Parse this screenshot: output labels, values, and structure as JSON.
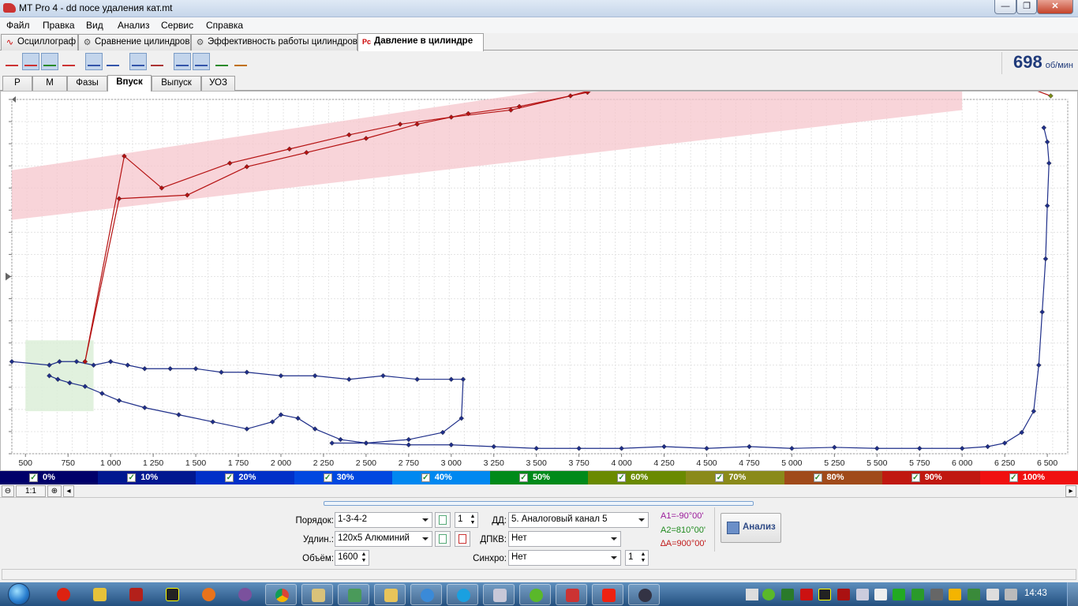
{
  "window": {
    "title": "MT Pro 4 - dd посе удаления кат.mt",
    "min_label": "—",
    "max_label": "❐",
    "close_label": "✕"
  },
  "menu": [
    "Файл",
    "Правка",
    "Вид",
    "Анализ",
    "Сервис",
    "Справка"
  ],
  "main_tabs": [
    {
      "label": "Осциллограф",
      "icon": "∿"
    },
    {
      "label": "Сравнение цилиндров",
      "icon": "⚙"
    },
    {
      "label": "Эффективность работы цилиндров",
      "icon": "⚙"
    },
    {
      "label": "Давление в цилиндре",
      "icon": "Pc"
    }
  ],
  "rpm": {
    "value": "698",
    "unit": "об/мин"
  },
  "sub_tabs": [
    "P",
    "M",
    "Фазы",
    "Впуск",
    "Выпуск",
    "УОЗ"
  ],
  "colors": {
    "band_fill": "#f5c6cc",
    "green_zone": "#dcefd8",
    "trace_blue": "#1f2f8a",
    "trace_red": "#b51212",
    "trace_olive": "#7a8a18"
  },
  "chart_data": {
    "type": "line",
    "x_ticks": [
      "500",
      "750",
      "1 000",
      "1 250",
      "1 500",
      "1 750",
      "2 000",
      "2 250",
      "2 500",
      "2 750",
      "3 000",
      "3 250",
      "3 500",
      "3 750",
      "4 000",
      "4 250",
      "4 500",
      "4 750",
      "5 000",
      "5 250",
      "5 500",
      "5 750",
      "6 000",
      "6 250",
      "6 500"
    ],
    "xlim": [
      420,
      6620
    ],
    "ylim": [
      0,
      100
    ],
    "series": [
      {
        "name": "blue-lower-loop",
        "color": "#1f2f8a",
        "values": [
          [
            640,
            22
          ],
          [
            690,
            21
          ],
          [
            760,
            20
          ],
          [
            850,
            19
          ],
          [
            950,
            17
          ],
          [
            1050,
            15
          ],
          [
            1200,
            13
          ],
          [
            1400,
            11
          ],
          [
            1600,
            9
          ],
          [
            1800,
            7
          ],
          [
            1950,
            9
          ],
          [
            2000,
            11
          ],
          [
            2100,
            10
          ],
          [
            2200,
            7
          ],
          [
            2350,
            4
          ],
          [
            2500,
            3
          ],
          [
            2750,
            2.5
          ],
          [
            3000,
            2.5
          ],
          [
            3250,
            2
          ],
          [
            3500,
            1.5
          ],
          [
            3750,
            1.5
          ],
          [
            4000,
            1.5
          ],
          [
            4250,
            2
          ],
          [
            4500,
            1.5
          ],
          [
            4750,
            2
          ],
          [
            5000,
            1.5
          ],
          [
            5250,
            1.8
          ],
          [
            5500,
            1.5
          ],
          [
            5750,
            1.5
          ],
          [
            6000,
            1.5
          ],
          [
            6150,
            2
          ],
          [
            6250,
            3
          ],
          [
            6350,
            6
          ],
          [
            6420,
            12
          ],
          [
            6450,
            25
          ],
          [
            6470,
            40
          ],
          [
            6490,
            55
          ],
          [
            6500,
            70
          ],
          [
            6510,
            82
          ],
          [
            6500,
            88
          ],
          [
            6480,
            92
          ]
        ]
      },
      {
        "name": "blue-upper-loop",
        "color": "#1f2f8a",
        "values": [
          [
            420,
            26
          ],
          [
            640,
            25
          ],
          [
            700,
            26
          ],
          [
            800,
            26
          ],
          [
            900,
            25
          ],
          [
            1000,
            26
          ],
          [
            1100,
            25
          ],
          [
            1200,
            24
          ],
          [
            1350,
            24
          ],
          [
            1500,
            24
          ],
          [
            1650,
            23
          ],
          [
            1800,
            23
          ],
          [
            2000,
            22
          ],
          [
            2200,
            22
          ],
          [
            2400,
            21
          ],
          [
            2600,
            22
          ],
          [
            2800,
            21
          ],
          [
            3000,
            21
          ],
          [
            3070,
            21
          ],
          [
            3060,
            10
          ],
          [
            2950,
            6
          ],
          [
            2750,
            4
          ],
          [
            2500,
            3
          ],
          [
            2300,
            3
          ]
        ]
      },
      {
        "name": "red-lower-trace",
        "color": "#b51212",
        "values": [
          [
            850,
            26
          ],
          [
            1050,
            72
          ],
          [
            1450,
            73
          ],
          [
            1800,
            81
          ],
          [
            2150,
            85
          ],
          [
            2500,
            89
          ],
          [
            2800,
            93
          ],
          [
            3100,
            96
          ],
          [
            3400,
            98
          ],
          [
            3800,
            102
          ],
          [
            4100,
            107
          ],
          [
            4400,
            114
          ],
          [
            4600,
            114
          ],
          [
            4850,
            110
          ],
          [
            5100,
            112
          ],
          [
            5350,
            114
          ],
          [
            5600,
            114
          ],
          [
            5850,
            112
          ],
          [
            6000,
            110
          ],
          [
            6200,
            107
          ],
          [
            6400,
            103
          ]
        ]
      },
      {
        "name": "red-upper-trace",
        "color": "#b51212",
        "values": [
          [
            850,
            26
          ],
          [
            1080,
            84
          ],
          [
            1300,
            75
          ],
          [
            1700,
            82
          ],
          [
            2050,
            86
          ],
          [
            2400,
            90
          ],
          [
            2700,
            93
          ],
          [
            3000,
            95
          ],
          [
            3350,
            97
          ],
          [
            3700,
            101
          ],
          [
            4000,
            105
          ],
          [
            4250,
            110
          ],
          [
            4450,
            114
          ],
          [
            4700,
            113
          ],
          [
            5000,
            111
          ],
          [
            5250,
            113
          ],
          [
            5500,
            114
          ],
          [
            5800,
            113
          ],
          [
            6100,
            109
          ],
          [
            6350,
            104
          ],
          [
            6520,
            101
          ]
        ]
      }
    ]
  },
  "legend": [
    "0%",
    "10%",
    "20%",
    "30%",
    "40%",
    "50%",
    "60%",
    "70%",
    "80%",
    "90%",
    "100%"
  ],
  "legend_colors": [
    "#00006a",
    "#001890",
    "#0030c8",
    "#0048e0",
    "#0088f0",
    "#008a1a",
    "#6a8a00",
    "#8a8a1a",
    "#a04a1a",
    "#c01810",
    "#f01010"
  ],
  "scroll": {
    "ratio": "1:1"
  },
  "panel": {
    "order_label": "Порядок:",
    "order_value": "1-3-4-2",
    "order_num": "1",
    "extension_label": "Удлин.:",
    "extension_value": "120x5 Алюминий",
    "volume_label": "Объём:",
    "volume_value": "1600",
    "dd_label": "ДД:",
    "dd_value": "5. Аналоговый канал 5",
    "dpkv_label": "ДПКВ:",
    "dpkv_value": "Нет",
    "sync_label": "Синхро:",
    "sync_value": "Нет",
    "sync_num": "1",
    "a1": "A1=-90°00'",
    "a2": "A2=810°00'",
    "da": "∆A=900°00'",
    "analyze_label": "Анализ"
  },
  "taskbar": {
    "clock": "14:43"
  }
}
